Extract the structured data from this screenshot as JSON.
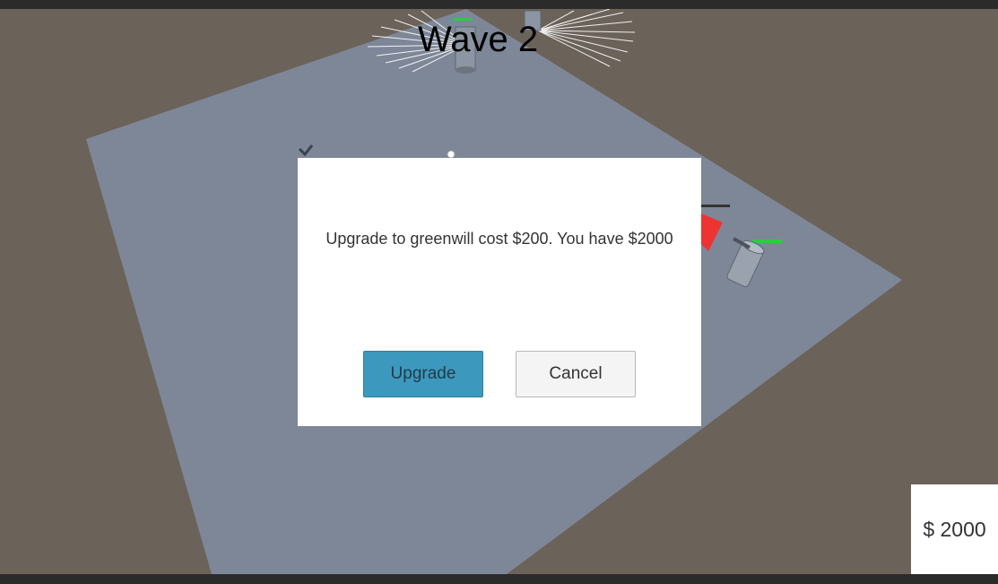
{
  "hud": {
    "wave_label": "Wave 2",
    "money_label": "$ 2000"
  },
  "dialog": {
    "message": "Upgrade to greenwill cost $200. You have $2000",
    "upgrade_label": "Upgrade",
    "cancel_label": "Cancel"
  },
  "colors": {
    "background": "#6b625a",
    "ground": "#7e8797",
    "health_bar": "#2ecc40",
    "enemy": "#ee3333",
    "button_primary": "#3d98bd"
  }
}
